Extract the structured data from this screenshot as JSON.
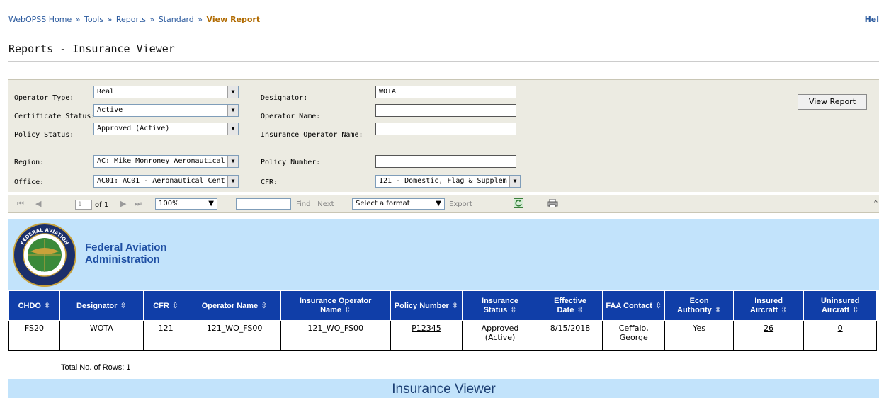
{
  "breadcrumb": {
    "items": [
      "WebOPSS Home",
      "Tools",
      "Reports",
      "Standard"
    ],
    "separator": "»",
    "current": "View Report"
  },
  "help_link": "Hel",
  "page_title": "Reports - Insurance Viewer",
  "params": {
    "operator_type": {
      "label": "Operator Type:",
      "value": "Real"
    },
    "certificate_status": {
      "label": "Certificate Status:",
      "value": "Active"
    },
    "policy_status": {
      "label": "Policy Status:",
      "value": "Approved (Active)"
    },
    "region": {
      "label": "Region:",
      "value": "AC: Mike Monroney Aeronautical"
    },
    "office": {
      "label": "Office:",
      "value": "AC01: AC01 - Aeronautical Cent"
    },
    "designator": {
      "label": "Designator:",
      "value": "WOTA"
    },
    "operator_name": {
      "label": "Operator Name:",
      "value": ""
    },
    "insurance_operator_name": {
      "label": "Insurance Operator Name:",
      "value": ""
    },
    "policy_number": {
      "label": "Policy Number:",
      "value": ""
    },
    "cfr": {
      "label": "CFR:",
      "value": "121 - Domestic, Flag & Supplem"
    },
    "view_report_label": "View Report"
  },
  "toolbar": {
    "page_value": "1",
    "of_text": "of 1",
    "zoom": "100%",
    "find": "Find",
    "divider": "|",
    "next": "Next",
    "format": "Select a format",
    "export": "Export",
    "nav_first": "⏮",
    "nav_prev": "◀",
    "nav_next": "▶",
    "nav_last": "⏭",
    "collapse": "⌃"
  },
  "report": {
    "org_name_line1": "Federal Aviation",
    "org_name_line2": "Administration",
    "seal_text_top": "FEDERAL AVIATION",
    "seal_text_bottom": "ADMINISTRATION",
    "columns": [
      "CHDO",
      "Designator",
      "CFR",
      "Operator Name",
      "Insurance Operator Name",
      "Policy Number",
      "Insurance Status",
      "Effective Date",
      "FAA Contact",
      "Econ Authority",
      "Insured Aircraft",
      "Uninsured Aircraft"
    ],
    "rows": [
      {
        "chdo": "FS20",
        "designator": "WOTA",
        "cfr": "121",
        "operator_name": "121_WO_FS00",
        "insurance_operator_name": "121_WO_FS00",
        "policy_number": "P12345",
        "insurance_status": "Approved (Active)",
        "effective_date": "8/15/2018",
        "faa_contact": "Ceffalo, George",
        "econ_authority": "Yes",
        "insured_aircraft": "26",
        "uninsured_aircraft": "0"
      }
    ],
    "total_rows": "Total No. of Rows: 1",
    "footer_title": "Insurance Viewer"
  },
  "sort_glyph": "⇳",
  "colors": {
    "header_blue": "#103ea8",
    "banner_light_blue": "#c2e3fb",
    "panel_beige": "#ecebe2",
    "link_blue": "#2b5a9e",
    "current_orange": "#b06a00"
  }
}
